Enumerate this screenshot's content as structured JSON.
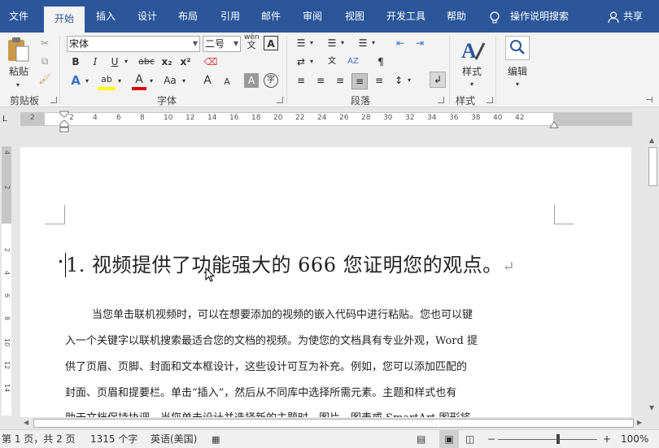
{
  "tabs": [
    "文件",
    "开始",
    "插入",
    "设计",
    "布局",
    "引用",
    "邮件",
    "审阅",
    "视图",
    "开发工具",
    "帮助"
  ],
  "tell_me": "操作说明搜索",
  "share": "共享",
  "clipboard": {
    "paste": "粘贴",
    "group": "剪贴板"
  },
  "font": {
    "name": "宋体",
    "size": "二号",
    "group": "字体",
    "wen": "wén",
    "wen2": "文",
    "bold": "B",
    "italic": "I",
    "underline": "U",
    "strike": "abc",
    "sub": "x₂",
    "sup": "x²",
    "effects": "A",
    "highlight": "ab",
    "color": "A",
    "case": "Aa",
    "grow": "A",
    "shrink": "A",
    "shade": "A",
    "enclose": "字"
  },
  "paragraph": {
    "group": "段落"
  },
  "styles": {
    "label": "样式",
    "group": "样式"
  },
  "editing": {
    "label": "编辑"
  },
  "ruler_numbers": [
    "2",
    "2",
    "4",
    "6",
    "8",
    "10",
    "12",
    "14",
    "16",
    "18",
    "20",
    "22",
    "24",
    "26",
    "28",
    "30",
    "32",
    "34",
    "36",
    "38",
    "40",
    "42"
  ],
  "vruler_numbers": [
    "4",
    "2",
    "2",
    "4",
    "6",
    "8",
    "10",
    "12",
    "14"
  ],
  "document": {
    "heading": "1. 视频提供了功能强大的 666 您证明您的观点。",
    "paragraph_lines": [
      "当您单击联机视频时，可以在想要添加的视频的嵌入代码中进行粘贴。您也可以键",
      "入一个关键字以联机搜索最适合您的文档的视频。为使您的文档具有专业外观，Word 提",
      "供了页眉、页脚、封面和文本框设计，这些设计可互为补充。例如，您可以添加匹配的",
      "封面、页眉和提要栏。单击“插入”，然后从不同库中选择所需元素。主题和样式也有",
      "助于文档保持协调。当您单击设计并选择新的主题时，图片、图表或 SmartArt 图形将"
    ]
  },
  "status": {
    "page": "第 1 页，共 2 页",
    "words": "1315 个字",
    "language": "英语(美国)",
    "zoom": "100%",
    "minus": "−",
    "plus": "+"
  }
}
